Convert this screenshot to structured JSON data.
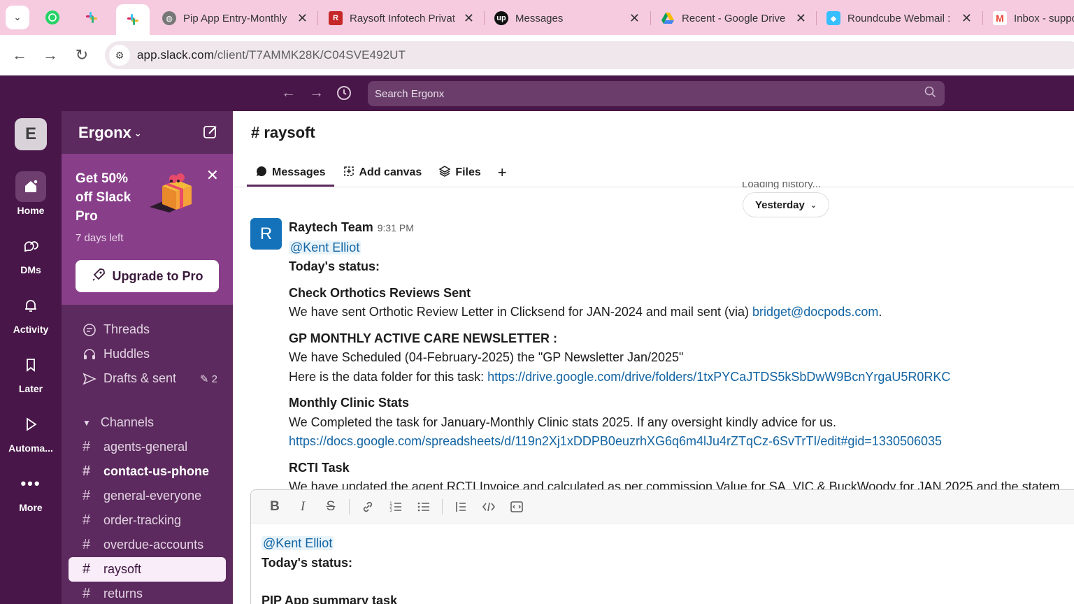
{
  "browser": {
    "tabs": [
      {
        "title": "Pip App Entry-Monthly",
        "icon": "globe-icon"
      },
      {
        "title": "Raysoft Infotech Privat",
        "icon": "raysoft-icon"
      },
      {
        "title": "Messages",
        "icon": "upwork-icon"
      },
      {
        "title": "Recent - Google Drive",
        "icon": "drive-icon"
      },
      {
        "title": "Roundcube Webmail :",
        "icon": "roundcube-icon"
      },
      {
        "title": "Inbox - suppo",
        "icon": "gmail-icon"
      }
    ],
    "url_host": "app.slack.com",
    "url_path": "/client/T7AMMK28K/C04SVE492UT"
  },
  "slack": {
    "search_placeholder": "Search Ergonx",
    "workspace_initial": "E",
    "rail": [
      {
        "label": "Home",
        "icon": "home-icon"
      },
      {
        "label": "DMs",
        "icon": "dms-icon"
      },
      {
        "label": "Activity",
        "icon": "bell-icon"
      },
      {
        "label": "Later",
        "icon": "bookmark-icon"
      },
      {
        "label": "Automa...",
        "icon": "play-icon"
      },
      {
        "label": "More",
        "icon": "more-icon"
      }
    ],
    "workspace_name": "Ergonx",
    "promo": {
      "title": "Get 50% off Slack Pro",
      "days_left": "7 days left",
      "button": "Upgrade to Pro"
    },
    "nav": [
      {
        "label": "Threads",
        "icon": "threads-icon"
      },
      {
        "label": "Huddles",
        "icon": "headphones-icon"
      },
      {
        "label": "Drafts & sent",
        "icon": "send-icon",
        "badge": "2"
      }
    ],
    "channels_header": "Channels",
    "channels": [
      {
        "name": "agents-general",
        "bold": false,
        "active": false
      },
      {
        "name": "contact-us-phone",
        "bold": true,
        "active": false
      },
      {
        "name": "general-everyone",
        "bold": false,
        "active": false
      },
      {
        "name": "order-tracking",
        "bold": false,
        "active": false
      },
      {
        "name": "overdue-accounts",
        "bold": false,
        "active": false
      },
      {
        "name": "raysoft",
        "bold": false,
        "active": true
      },
      {
        "name": "returns",
        "bold": false,
        "active": false
      }
    ],
    "channel": {
      "title": "raysoft",
      "tabs": [
        "Messages",
        "Add canvas",
        "Files"
      ],
      "loading": "Loading history...",
      "day_divider": "Yesterday"
    },
    "message": {
      "avatar": "R",
      "author": "Raytech Team",
      "time": "9:31 PM",
      "mention": "@Kent Elliot",
      "status_heading": "Today's status:",
      "sections": [
        {
          "heading": "Check Orthotics Reviews Sent",
          "line1": "We have sent Orthotic Review Letter in Clicksend for JAN-2024 and mail sent (via) ",
          "link1": "bridget@docpods.com",
          "tail1": "."
        },
        {
          "heading": "GP MONTHLY ACTIVE CARE NEWSLETTER :",
          "line1": "We have Scheduled (04-February-2025) the \"GP Newsletter Jan/2025\"",
          "line2": "Here is the data folder for this task: ",
          "link2": "https://drive.google.com/drive/folders/1txPYCaJTDS5kSbDwW9BcnYrgaU5R0RKC"
        },
        {
          "heading": "Monthly Clinic Stats",
          "line1": "We Completed the task for January-Monthly Clinic stats 2025. If any oversight kindly advice for us.",
          "link2": "https://docs.google.com/spreadsheets/d/119n2Xj1xDDPB0euzrhXG6q6m4lJu4rZTqCz-6SvTrTI/edit#gid=1330506035"
        },
        {
          "heading": "RCTI Task",
          "line1": "We have updated the agent RCTI Invoice and calculated as per commission Value for SA, VIC & BuckWoody for JAN 2025 and the statem"
        }
      ]
    },
    "composer": {
      "mention": "@Kent Elliot",
      "line1": "Today's status:",
      "line2": "PIP App summary task"
    }
  }
}
